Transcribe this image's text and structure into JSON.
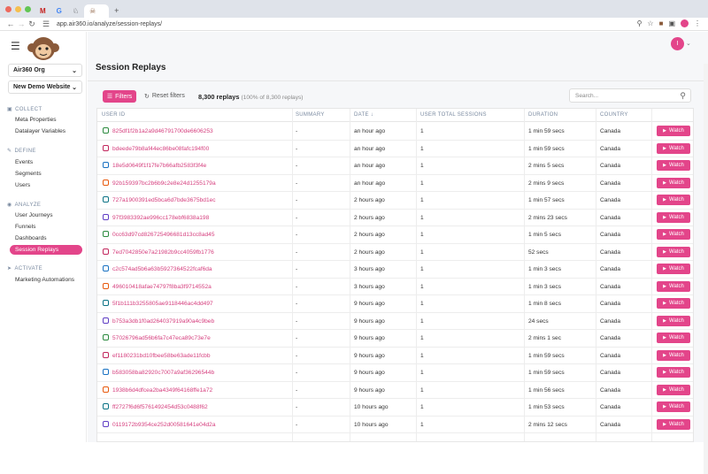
{
  "browser": {
    "url": "app.air360.io/analyze/session-replays/",
    "tab_glyphs": [
      "M",
      "G",
      "♘",
      "☠"
    ],
    "new_tab": "+"
  },
  "sidebar": {
    "org": "Air360 Org",
    "site": "New Demo Website",
    "sections": [
      {
        "title": "COLLECT",
        "items": [
          "Meta Properties",
          "Datalayer Variables"
        ]
      },
      {
        "title": "DEFINE",
        "items": [
          "Events",
          "Segments",
          "Users"
        ]
      },
      {
        "title": "ANALYZE",
        "items": [
          "User Journeys",
          "Funnels",
          "Dashboards",
          "Session Replays"
        ]
      },
      {
        "title": "ACTIVATE",
        "items": [
          "Marketing Automations"
        ]
      }
    ],
    "active_item": "Session Replays"
  },
  "header": {
    "title": "Session Replays",
    "avatar": "I"
  },
  "toolbar": {
    "filters": "Filters",
    "reset": "Reset filters",
    "count": "8,300 replays",
    "count_note": "(100% of 8,300 replays)",
    "search_placeholder": "Search..."
  },
  "table": {
    "columns": [
      "USER ID",
      "SUMMARY",
      "DATE",
      "USER TOTAL SESSIONS",
      "DURATION",
      "COUNTRY"
    ],
    "watch_label": "Watch",
    "rows": [
      [
        "825df1f2b1a2a9d46791700de6606253",
        "-",
        "an hour ago",
        "1",
        "1 min 59 secs",
        "Canada"
      ],
      [
        "bdeede79b8af44ec86be08fafc194f00",
        "-",
        "an hour ago",
        "1",
        "1 min 59 secs",
        "Canada"
      ],
      [
        "18e5d0649f1f17fe7b66afb2583f3f4e",
        "-",
        "an hour ago",
        "1",
        "2 mins 5 secs",
        "Canada"
      ],
      [
        "92b159397bc2b6b9c2e8e24d1255179a",
        "-",
        "an hour ago",
        "1",
        "2 mins 9 secs",
        "Canada"
      ],
      [
        "727a1900391ed5bca6d7bde3675bd1ec",
        "-",
        "2 hours ago",
        "1",
        "1 min 57 secs",
        "Canada"
      ],
      [
        "97f3983392ae996cc178ebf6838a198",
        "-",
        "2 hours ago",
        "1",
        "2 mins 23 secs",
        "Canada"
      ],
      [
        "0cc63d97cd826725496681d13cc8ad45",
        "-",
        "2 hours ago",
        "1",
        "1 min 5 secs",
        "Canada"
      ],
      [
        "7ed7042850e7a21982b9cc4059fb1776",
        "-",
        "2 hours ago",
        "1",
        "52 secs",
        "Canada"
      ],
      [
        "c2c574ad5b6a63b5927364522fcaf6da",
        "-",
        "3 hours ago",
        "1",
        "1 min 3 secs",
        "Canada"
      ],
      [
        "496010418afae74797f8ba3f9714552a",
        "-",
        "3 hours ago",
        "1",
        "1 min 3 secs",
        "Canada"
      ],
      [
        "5f1b111b3255805ae9118446ac4dd497",
        "-",
        "9 hours ago",
        "1",
        "1 min 8 secs",
        "Canada"
      ],
      [
        "b753a3db1f0ad264037919a90a4c9beb",
        "-",
        "9 hours ago",
        "1",
        "24 secs",
        "Canada"
      ],
      [
        "57026796ad56b6fa7c47eca89c73e7e",
        "-",
        "9 hours ago",
        "1",
        "2 mins 1 sec",
        "Canada"
      ],
      [
        "ef1180231bd10fbee58be63ade11fcbb",
        "-",
        "9 hours ago",
        "1",
        "1 min 59 secs",
        "Canada"
      ],
      [
        "b583058ba82920c7007a9af36296544b",
        "-",
        "9 hours ago",
        "1",
        "1 min 59 secs",
        "Canada"
      ],
      [
        "1938b6d4dfcea2ba4349f64168ffe1a72",
        "-",
        "9 hours ago",
        "1",
        "1 min 56 secs",
        "Canada"
      ],
      [
        "ff2727f6d6f5761492454d53c0488f62",
        "-",
        "10 hours ago",
        "1",
        "1 min 53 secs",
        "Canada"
      ],
      [
        "0119172b9354ce252d00581641e04d2a",
        "-",
        "10 hours ago",
        "1",
        "2 mins 12 secs",
        "Canada"
      ]
    ]
  },
  "colors": {
    "accent": "#e3458a",
    "link": "#d6407f"
  }
}
